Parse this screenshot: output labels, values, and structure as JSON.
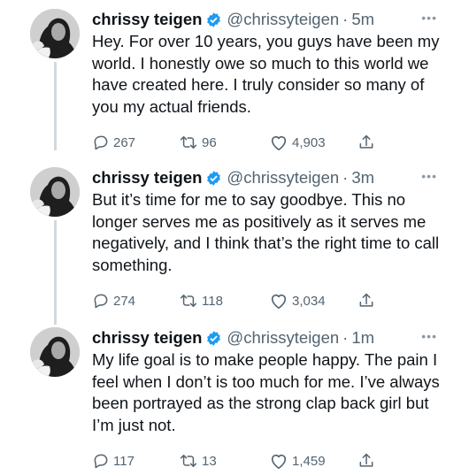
{
  "tweets": [
    {
      "author": "chrissy teigen",
      "handle": "@chrissyteigen",
      "separator": "·",
      "time": "5m",
      "more": "•••",
      "text": "Hey. For over 10 years, you guys have been my world. I honestly owe so much to this world we have created here. I truly consider so many of you my actual friends.",
      "replies": "267",
      "retweets": "96",
      "likes": "4,903"
    },
    {
      "author": "chrissy teigen",
      "handle": "@chrissyteigen",
      "separator": "·",
      "time": "3m",
      "more": "•••",
      "text": "But it’s time for me to say goodbye. This no longer serves me as positively as it serves me negatively, and I think that’s the right time to call something.",
      "replies": "274",
      "retweets": "118",
      "likes": "3,034"
    },
    {
      "author": "chrissy teigen",
      "handle": "@chrissyteigen",
      "separator": "·",
      "time": "1m",
      "more": "•••",
      "text": "My life goal is to make people happy. The pain I feel when I don’t is too much for me. I’ve always been portrayed as the strong clap back girl but I’m just not.",
      "replies": "117",
      "retweets": "13",
      "likes": "1,459"
    }
  ],
  "icons": {
    "verified": "verified-badge-icon",
    "reply": "reply-icon",
    "retweet": "retweet-icon",
    "like": "heart-icon",
    "share": "share-icon",
    "more": "more-icon"
  },
  "colors": {
    "verified": "#1d9bf0",
    "text": "#0f1419",
    "secondary": "#536471",
    "thread_line": "#cfd9de"
  }
}
